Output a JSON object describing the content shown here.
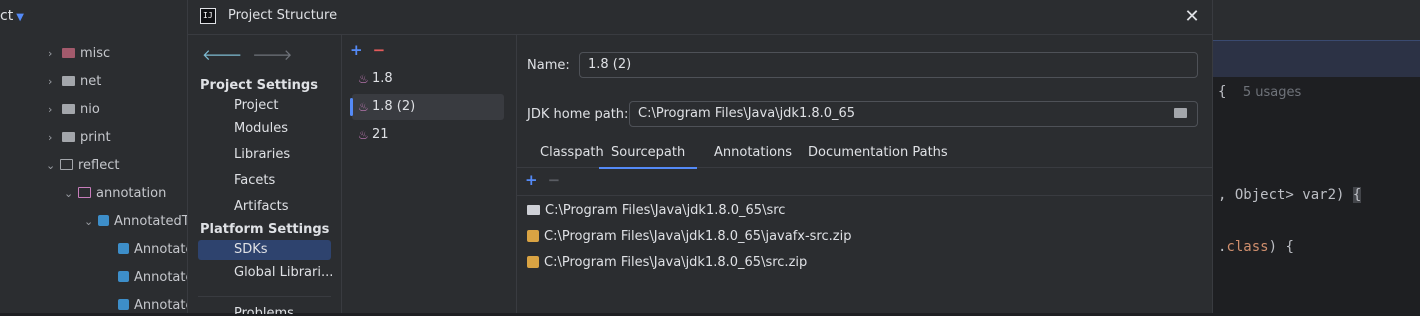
{
  "background_ide": {
    "project_header": "ct",
    "tree": [
      {
        "label": "misc",
        "expanded": false
      },
      {
        "label": "net",
        "expanded": false
      },
      {
        "label": "nio",
        "expanded": false
      },
      {
        "label": "print",
        "expanded": false
      },
      {
        "label": "reflect",
        "expanded": true
      },
      {
        "label": "annotation",
        "expanded": true
      },
      {
        "label": "AnnotatedTy",
        "expanded": true
      },
      {
        "label": "Annotate"
      },
      {
        "label": "Annotate"
      },
      {
        "label": "Annotate"
      }
    ],
    "code": {
      "brace_open": "{",
      "usages_hint": "5 usages",
      "line1": ", Object> var2) ",
      "line1_brace": "{",
      "line2_prefix": ".",
      "line2_kw": "class",
      "line2_suffix": ") {"
    }
  },
  "dialog": {
    "title": "Project Structure",
    "close_symbol": "✕",
    "nav": {
      "back_symbol": "🡐",
      "forward_symbol": "🡒",
      "project_settings_heading": "Project Settings",
      "project_settings": [
        "Project",
        "Modules",
        "Libraries",
        "Facets",
        "Artifacts"
      ],
      "platform_settings_heading": "Platform Settings",
      "platform_settings": [
        "SDKs",
        "Global Librari..."
      ],
      "selected": "SDKs",
      "partial_bottom_item": "Problems"
    },
    "sdk_list": {
      "add_symbol": "+",
      "remove_symbol": "−",
      "items": [
        "1.8",
        "1.8 (2)",
        "21"
      ],
      "selected": "1.8 (2)"
    },
    "detail": {
      "name_label": "Name:",
      "name_value": "1.8 (2)",
      "jdk_home_label": "JDK home path:",
      "jdk_home_value": "C:\\Program Files\\Java\\jdk1.8.0_65",
      "tabs": [
        "Classpath",
        "Sourcepath",
        "Annotations",
        "Documentation Paths"
      ],
      "active_tab": "Sourcepath",
      "add_symbol": "+",
      "remove_symbol": "−",
      "paths": [
        {
          "type": "folder-icon",
          "path": "C:\\Program Files\\Java\\jdk1.8.0_65\\src"
        },
        {
          "type": "zip-icon",
          "path": "C:\\Program Files\\Java\\jdk1.8.0_65\\javafx-src.zip"
        },
        {
          "type": "zip-icon",
          "path": "C:\\Program Files\\Java\\jdk1.8.0_65\\src.zip"
        }
      ]
    }
  },
  "colors": {
    "accent": "#548af7",
    "selection": "#2e436e",
    "dialog_bg": "#2b2d30",
    "editor_bg": "#1e1f22"
  }
}
